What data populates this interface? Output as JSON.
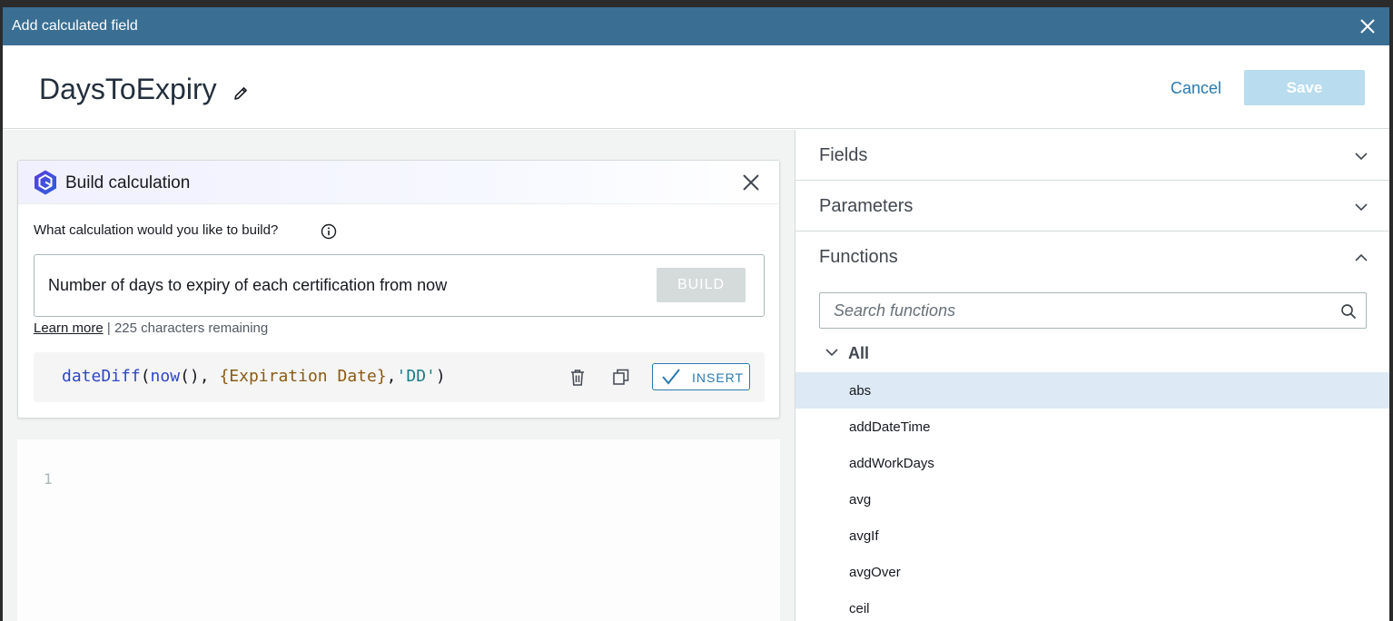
{
  "dialog": {
    "title": "Add calculated field",
    "field_name": "DaysToExpiry",
    "cancel_label": "Cancel",
    "save_label": "Save"
  },
  "build_panel": {
    "title": "Build calculation",
    "question": "What calculation would you like to build?",
    "prompt_value": "Number of days to expiry of each certification from now",
    "build_label": "BUILD",
    "learn_more": "Learn more",
    "separator": "|",
    "remaining": "225 characters remaining",
    "result": {
      "fn": "dateDiff",
      "open": "(",
      "inner_fn": "now",
      "inner_parens": "()",
      "comma1": ", ",
      "field": "{Expiration Date}",
      "comma2": ",",
      "str": "'DD'",
      "close": ")"
    },
    "insert_label": "INSERT"
  },
  "editor": {
    "line_number": "1"
  },
  "right_panel": {
    "sections": {
      "fields": "Fields",
      "parameters": "Parameters",
      "functions": "Functions"
    },
    "search_placeholder": "Search functions",
    "group_label": "All",
    "functions": [
      "abs",
      "addDateTime",
      "addWorkDays",
      "avg",
      "avgIf",
      "avgOver",
      "ceil"
    ],
    "selected_function": "abs"
  },
  "icons": {
    "close": "close-icon",
    "edit": "pencil-icon",
    "logo": "ai-hexagon-logo",
    "info": "info-icon",
    "delete": "trash-icon",
    "copy": "copy-icon",
    "check": "check-icon",
    "search": "search-icon",
    "chevron_down": "chevron-down-icon",
    "chevron_up": "chevron-up-icon"
  },
  "colors": {
    "titlebar": "#3a6f93",
    "accent": "#2a7ab0",
    "save_disabled": "#b9dcee",
    "selected_row": "#dde9f4"
  }
}
